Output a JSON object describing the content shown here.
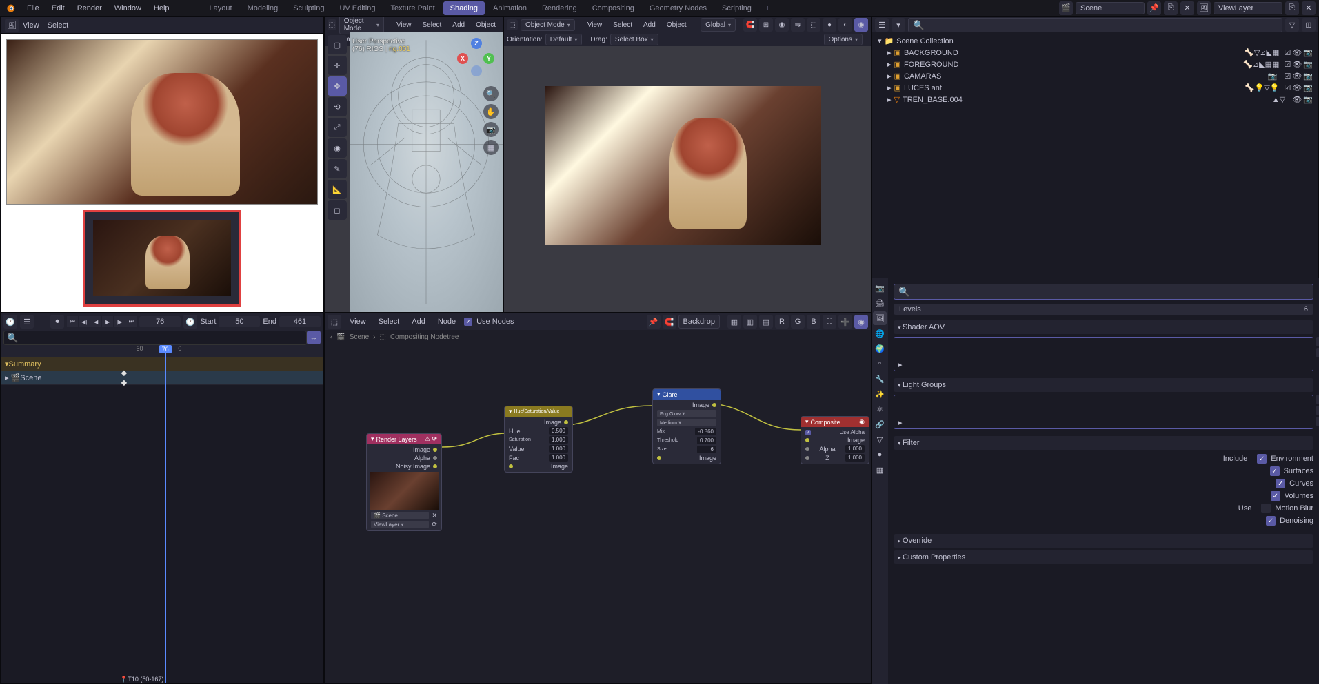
{
  "topmenu": {
    "file": "File",
    "edit": "Edit",
    "render": "Render",
    "window": "Window",
    "help": "Help"
  },
  "workspaces": [
    "Layout",
    "Modeling",
    "Sculpting",
    "UV Editing",
    "Texture Paint",
    "Shading",
    "Animation",
    "Rendering",
    "Compositing",
    "Geometry Nodes",
    "Scripting"
  ],
  "active_ws_index": 5,
  "scene_name": "Scene",
  "viewlayer_name": "ViewLayer",
  "image_editor": {
    "view": "View",
    "select": "Select"
  },
  "viewport": {
    "mode": "Object Mode",
    "menus": {
      "view": "View",
      "select": "Select",
      "add": "Add",
      "object": "Object"
    },
    "orientation_lbl": "Orientation:",
    "orientation": "Default",
    "drag_lbl": "Drag:",
    "drag": "Select Box",
    "global": "Global",
    "options": "Options",
    "perspective": "User Perspective",
    "info_line": "(76) RIGS | ",
    "obj_name": "rig.001"
  },
  "outliner": {
    "root": "Scene Collection",
    "items": [
      {
        "name": "BACKGROUND",
        "type": "collection"
      },
      {
        "name": "FOREGROUND",
        "type": "collection"
      },
      {
        "name": "CAMARAS",
        "type": "collection"
      },
      {
        "name": "LUCES ant",
        "type": "collection"
      },
      {
        "name": "TREN_BASE.004",
        "type": "mesh"
      }
    ]
  },
  "properties": {
    "levels_label": "Levels",
    "levels_value": "6",
    "sections": {
      "shader_aov": "Shader AOV",
      "light_groups": "Light Groups",
      "filter": "Filter",
      "override": "Override",
      "custom": "Custom Properties"
    },
    "filter": {
      "include": "Include",
      "use": "Use",
      "environment": "Environment",
      "surfaces": "Surfaces",
      "curves": "Curves",
      "volumes": "Volumes",
      "motion_blur": "Motion Blur",
      "denoising": "Denoising"
    }
  },
  "dopesheet": {
    "frame": "76",
    "start_lbl": "Start",
    "start": "50",
    "end_lbl": "End",
    "end": "461",
    "summary": "Summary",
    "scene": "Scene",
    "marker": "T10 (50-167)",
    "ticks": [
      "60",
      "0"
    ]
  },
  "compositor": {
    "menus": {
      "view": "View",
      "select": "Select",
      "add": "Add",
      "node": "Node"
    },
    "use_nodes": "Use Nodes",
    "backdrop": "Backdrop",
    "breadcrumb": {
      "scene": "Scene",
      "tree": "Compositing Nodetree"
    },
    "nodes": {
      "render_layers": {
        "title": "Render Layers",
        "outputs": [
          "Image",
          "Alpha",
          "Noisy Image"
        ],
        "scene": "Scene",
        "layer": "ViewLayer"
      },
      "hsv": {
        "title": "Hue/Saturation/Value",
        "out": "Image",
        "rows": [
          {
            "lbl": "Hue",
            "val": "0.500"
          },
          {
            "lbl": "Saturation",
            "val": "1.000"
          },
          {
            "lbl": "Value",
            "val": "1.000"
          },
          {
            "lbl": "Fac",
            "val": "1.000"
          }
        ],
        "in": "Image"
      },
      "glare": {
        "title": "Glare",
        "out": "Image",
        "type": "Fog Glow",
        "quality": "Medium",
        "rows": [
          {
            "lbl": "Mix",
            "val": "-0.860"
          },
          {
            "lbl": "Threshold",
            "val": "0.700"
          },
          {
            "lbl": "Size",
            "val": "6"
          }
        ],
        "in": "Image"
      },
      "composite": {
        "title": "Composite",
        "use_alpha": "Use Alpha",
        "rows": [
          {
            "lbl": "Image",
            "val": ""
          },
          {
            "lbl": "Alpha",
            "val": "1.000"
          },
          {
            "lbl": "Z",
            "val": "1.000"
          }
        ]
      }
    }
  }
}
